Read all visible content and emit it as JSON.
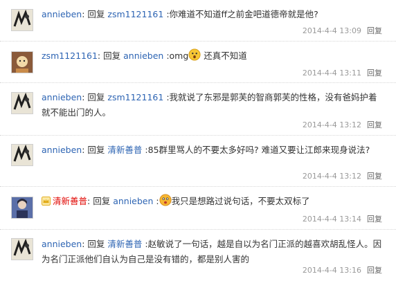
{
  "reply_keyword": "回复",
  "comments": [
    {
      "user": "annieben",
      "target": "zsm1121161",
      "text": ":你难道不知道ff之前金吧道德帝就是他?",
      "time": "2014-4-4 13:09",
      "reply_label": "回复"
    },
    {
      "user": "zsm1121161",
      "target": "annieben",
      "text_before_emoji": ":omg",
      "text_after_emoji": " 还真不知道",
      "time": "2014-4-4 13:11",
      "reply_label": "回复"
    },
    {
      "user": "annieben",
      "target": "zsm1121161",
      "text": ":我就说了东邪是郭芙的智商郭芙的性格，没有爸妈护着就不能出门的人。",
      "time": "2014-4-4 13:12",
      "reply_label": "回复"
    },
    {
      "user": "annieben",
      "target": "清新善普",
      "text": ":85群里骂人的不要太多好吗? 难道又要让江郎来现身说法?",
      "time": "2014-4-4 13:12",
      "reply_label": "回复"
    },
    {
      "user": "清新善普",
      "target": "annieben",
      "text_before_emoji": " :",
      "text_after_emoji": "我只是想路过说句话，不要太双标了",
      "time": "2014-4-4 13:14",
      "reply_label": "回复"
    },
    {
      "user": "annieben",
      "target": "清新善普",
      "text": ":赵敏说了一句话，越是自以为名门正派的越喜欢胡乱怪人。因为名门正派他们自认为自己是没有错的，都是别人害的",
      "time": "2014-4-4 13:16",
      "reply_label": "回复"
    }
  ],
  "colors": {
    "username": "#2d64b3",
    "vip_username": "#e10602",
    "meta": "#999999"
  }
}
